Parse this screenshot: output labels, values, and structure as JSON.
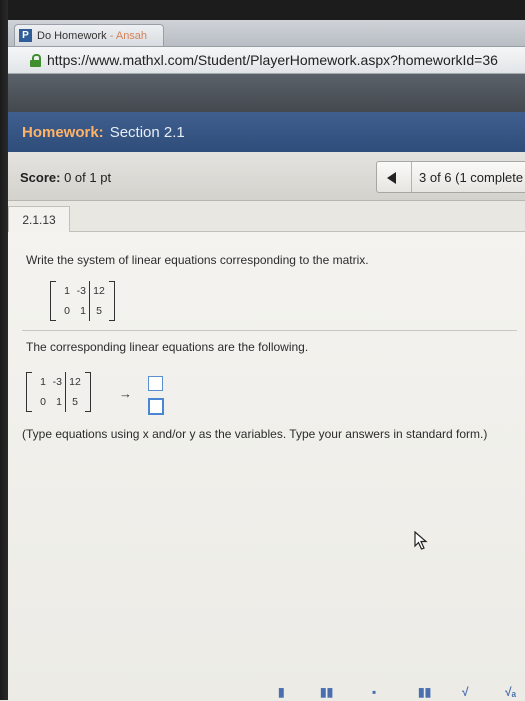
{
  "browser": {
    "tab_title": "Do Homework",
    "tab_title_dim": " - Ansah",
    "url": "https://www.mathxl.com/Student/PlayerHomework.aspx?homeworkId=36"
  },
  "header": {
    "label": "Homework:",
    "section": "Section 2.1"
  },
  "score": {
    "label": "Score:",
    "value": "0 of 1 pt"
  },
  "pager": {
    "text": "3 of 6 (1 complete"
  },
  "question": {
    "id": "2.1.13",
    "prompt": "Write the system of linear equations corresponding to the matrix.",
    "intro": "The corresponding linear equations are the following.",
    "instruction": "(Type equations using x and/or y as the variables. Type your answers in standard form.)",
    "matrix": [
      [
        "1",
        "-3",
        "12"
      ],
      [
        "0",
        "1",
        "5"
      ]
    ],
    "arrow": "→"
  },
  "tools": [
    "▮",
    "▮▮",
    "▪",
    "▮▮",
    "√",
    "√ₐ"
  ],
  "colors": {
    "header_bg": "#2f4d7a",
    "header_label": "#ffb366",
    "answer_box_border": "#4a86d4"
  }
}
